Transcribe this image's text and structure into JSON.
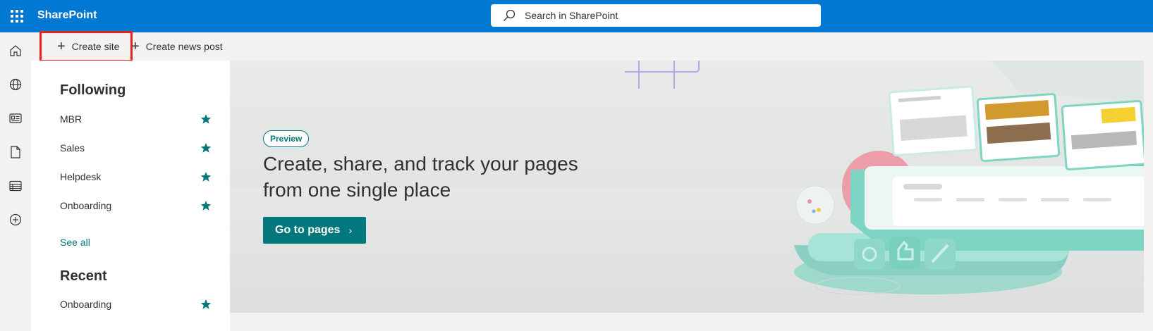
{
  "app": {
    "title": "SharePoint"
  },
  "search": {
    "placeholder": "Search in SharePoint"
  },
  "commands": {
    "create_site": "Create site",
    "create_news": "Create news post"
  },
  "following": {
    "title": "Following",
    "sites": [
      {
        "label": "MBR"
      },
      {
        "label": "Sales"
      },
      {
        "label": "Helpdesk"
      },
      {
        "label": "Onboarding"
      }
    ],
    "see_all": "See all"
  },
  "recent": {
    "title": "Recent",
    "sites": [
      {
        "label": "Onboarding"
      }
    ]
  },
  "hero": {
    "badge": "Preview",
    "title": "Create, share, and track your pages from one single place",
    "button": "Go to pages"
  },
  "rail": [
    "home-icon",
    "globe-icon",
    "news-icon",
    "document-icon",
    "list-icon",
    "add-circle-icon"
  ],
  "colors": {
    "brand": "#0078d4",
    "accent": "#03787c",
    "highlight": "#e8231e"
  }
}
